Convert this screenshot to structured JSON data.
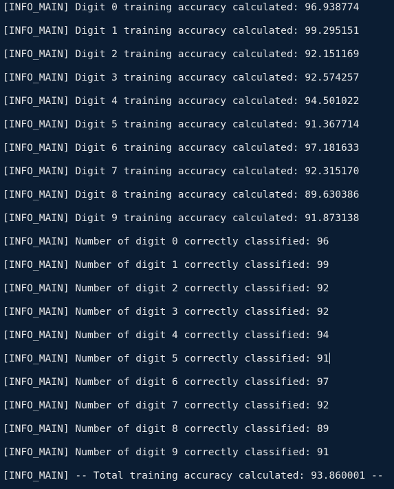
{
  "terminal": {
    "lines": [
      "[INFO_MAIN] Digit 0 training accuracy calculated: 96.938774",
      "[INFO_MAIN] Digit 1 training accuracy calculated: 99.295151",
      "[INFO_MAIN] Digit 2 training accuracy calculated: 92.151169",
      "[INFO_MAIN] Digit 3 training accuracy calculated: 92.574257",
      "[INFO_MAIN] Digit 4 training accuracy calculated: 94.501022",
      "[INFO_MAIN] Digit 5 training accuracy calculated: 91.367714",
      "[INFO_MAIN] Digit 6 training accuracy calculated: 97.181633",
      "[INFO_MAIN] Digit 7 training accuracy calculated: 92.315170",
      "[INFO_MAIN] Digit 8 training accuracy calculated: 89.630386",
      "[INFO_MAIN] Digit 9 training accuracy calculated: 91.873138",
      "[INFO_MAIN] Number of digit 0 correctly classified: 96",
      "[INFO_MAIN] Number of digit 1 correctly classified: 99",
      "[INFO_MAIN] Number of digit 2 correctly classified: 92",
      "[INFO_MAIN] Number of digit 3 correctly classified: 92",
      "[INFO_MAIN] Number of digit 4 correctly classified: 94",
      "[INFO_MAIN] Number of digit 5 correctly classified: 91",
      "[INFO_MAIN] Number of digit 6 correctly classified: 97",
      "[INFO_MAIN] Number of digit 7 correctly classified: 92",
      "[INFO_MAIN] Number of digit 8 correctly classified: 89",
      "[INFO_MAIN] Number of digit 9 correctly classified: 91",
      "[INFO_MAIN] -- Total training accuracy calculated: 93.860001 --"
    ]
  },
  "colors": {
    "background": "#0b1d33",
    "text": "#e6e6e6"
  }
}
